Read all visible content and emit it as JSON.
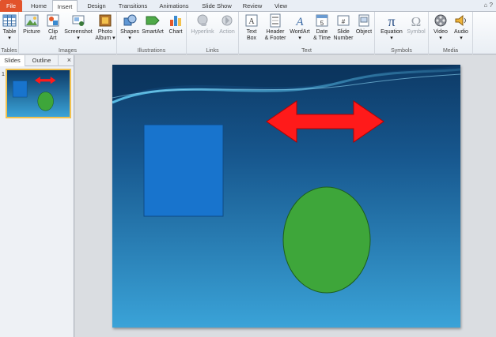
{
  "tabs": [
    {
      "label": "File"
    },
    {
      "label": "Home"
    },
    {
      "label": "Insert"
    },
    {
      "label": "Design"
    },
    {
      "label": "Transitions"
    },
    {
      "label": "Animations"
    },
    {
      "label": "Slide Show"
    },
    {
      "label": "Review"
    },
    {
      "label": "View"
    }
  ],
  "ribbon": {
    "groups": [
      {
        "label": "Tables",
        "commands": [
          {
            "l1": "Table",
            "l2": "▾",
            "icon": "table-icon"
          }
        ]
      },
      {
        "label": "Images",
        "commands": [
          {
            "l1": "Picture",
            "l2": "",
            "icon": "picture-icon"
          },
          {
            "l1": "Clip",
            "l2": "Art",
            "icon": "clip-art-icon"
          },
          {
            "l1": "Screenshot",
            "l2": "▾",
            "icon": "screenshot-icon"
          },
          {
            "l1": "Photo",
            "l2": "Album ▾",
            "icon": "photo-album-icon"
          }
        ]
      },
      {
        "label": "Illustrations",
        "commands": [
          {
            "l1": "Shapes",
            "l2": "▾",
            "icon": "shapes-icon"
          },
          {
            "l1": "SmartArt",
            "l2": "",
            "icon": "smartart-icon"
          },
          {
            "l1": "Chart",
            "l2": "",
            "icon": "chart-icon"
          }
        ]
      },
      {
        "label": "Links",
        "commands": [
          {
            "l1": "Hyperlink",
            "l2": "",
            "icon": "hyperlink-icon"
          },
          {
            "l1": "Action",
            "l2": "",
            "icon": "action-icon"
          }
        ]
      },
      {
        "label": "Text",
        "commands": [
          {
            "l1": "Text",
            "l2": "Box",
            "icon": "text-box-icon"
          },
          {
            "l1": "Header",
            "l2": "& Footer",
            "icon": "header-footer-icon"
          },
          {
            "l1": "WordArt",
            "l2": "▾",
            "icon": "wordart-icon"
          },
          {
            "l1": "Date",
            "l2": "& Time",
            "icon": "date-time-icon"
          },
          {
            "l1": "Slide",
            "l2": "Number",
            "icon": "slide-number-icon"
          },
          {
            "l1": "Object",
            "l2": "",
            "icon": "object-icon"
          }
        ]
      },
      {
        "label": "Symbols",
        "commands": [
          {
            "l1": "Equation",
            "l2": "▾",
            "icon": "equation-icon"
          },
          {
            "l1": "Symbol",
            "l2": "",
            "icon": "symbol-icon"
          }
        ]
      },
      {
        "label": "Media",
        "commands": [
          {
            "l1": "Video",
            "l2": "▾",
            "icon": "video-icon"
          },
          {
            "l1": "Audio",
            "l2": "▾",
            "icon": "audio-icon"
          }
        ]
      }
    ]
  },
  "pane": {
    "tabs": [
      {
        "label": "Slides"
      },
      {
        "label": "Outline"
      }
    ],
    "close": "×",
    "slide_number": "1"
  },
  "window_controls": "⌂ ?",
  "colors": {
    "file_tab": "#e2532b",
    "rectangle": "#1874cd",
    "ellipse": "#3ea63a",
    "arrow": "#ff1a1a",
    "slide_bg_top": "#0d3a66",
    "slide_bg_bottom": "#3aa3d8"
  }
}
